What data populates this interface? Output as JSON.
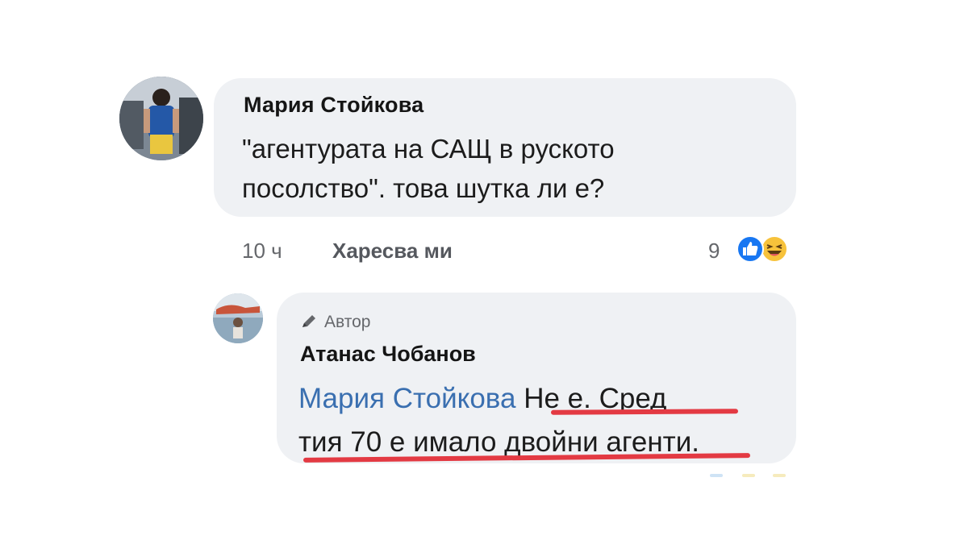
{
  "comment": {
    "author": "Мария Стойкова",
    "text_line1": "\"агентурата на САЩ в руското",
    "text_line2": "посолство\". това шутка ли е?",
    "avatar_icon": "user-photo",
    "time": "10 ч",
    "like_label": "Харесва ми",
    "reaction_count": "9",
    "reactions": [
      "like-icon",
      "haha-icon"
    ]
  },
  "reply": {
    "badge_label": "Автор",
    "badge_icon": "pencil-icon",
    "author": "Атанас Чобанов",
    "mention": "Мария Стойкова",
    "text_line1_rest": " Не е. Сред",
    "text_line2": "тия 70 е имало двойни агенти.",
    "avatar_icon": "user-photo"
  },
  "colors": {
    "bubble": "#eff1f4",
    "mention": "#3a6fb0",
    "underline": "#e33a43",
    "meta": "#65676b",
    "like_blue": "#1877f2",
    "haha_yellow": "#f7c23b"
  }
}
